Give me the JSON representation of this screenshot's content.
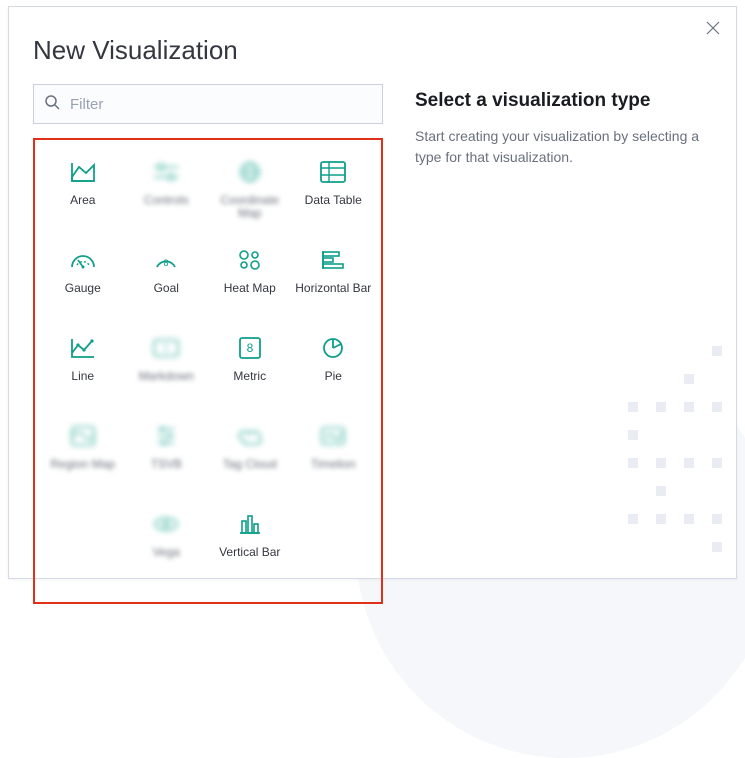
{
  "modal": {
    "title": "New Visualization",
    "close_label": "Close"
  },
  "search": {
    "placeholder": "Filter"
  },
  "viz_types": [
    {
      "id": "area",
      "label": "Area",
      "icon": "area",
      "blurred": false
    },
    {
      "id": "controls",
      "label": "Controls",
      "icon": "controls",
      "blurred": true
    },
    {
      "id": "coordinate-map",
      "label": "Coordinate Map",
      "icon": "coord-map",
      "blurred": true
    },
    {
      "id": "data-table",
      "label": "Data Table",
      "icon": "data-table",
      "blurred": false
    },
    {
      "id": "gauge",
      "label": "Gauge",
      "icon": "gauge",
      "blurred": false
    },
    {
      "id": "goal",
      "label": "Goal",
      "icon": "goal",
      "blurred": false
    },
    {
      "id": "heat-map",
      "label": "Heat Map",
      "icon": "heat-map",
      "blurred": false
    },
    {
      "id": "horizontal-bar",
      "label": "Horizontal Bar",
      "icon": "h-bar",
      "blurred": false
    },
    {
      "id": "line",
      "label": "Line",
      "icon": "line",
      "blurred": false
    },
    {
      "id": "markdown",
      "label": "Markdown",
      "icon": "markdown",
      "blurred": true
    },
    {
      "id": "metric",
      "label": "Metric",
      "icon": "metric",
      "blurred": false
    },
    {
      "id": "pie",
      "label": "Pie",
      "icon": "pie",
      "blurred": false
    },
    {
      "id": "region-map",
      "label": "Region Map",
      "icon": "region-map",
      "blurred": true
    },
    {
      "id": "tsvb",
      "label": "TSVB",
      "icon": "tsvb",
      "blurred": true
    },
    {
      "id": "tag-cloud",
      "label": "Tag Cloud",
      "icon": "tag-cloud",
      "blurred": true
    },
    {
      "id": "timelion",
      "label": "Timelion",
      "icon": "timelion",
      "blurred": true
    },
    {
      "id": "vega",
      "label": "Vega",
      "icon": "vega",
      "blurred": true
    },
    {
      "id": "vertical-bar",
      "label": "Vertical Bar",
      "icon": "v-bar",
      "blurred": false
    }
  ],
  "help": {
    "title": "Select a visualization type",
    "description": "Start creating your visualization by selecting a type for that visualization."
  },
  "accent_color": "#0e9f8a"
}
